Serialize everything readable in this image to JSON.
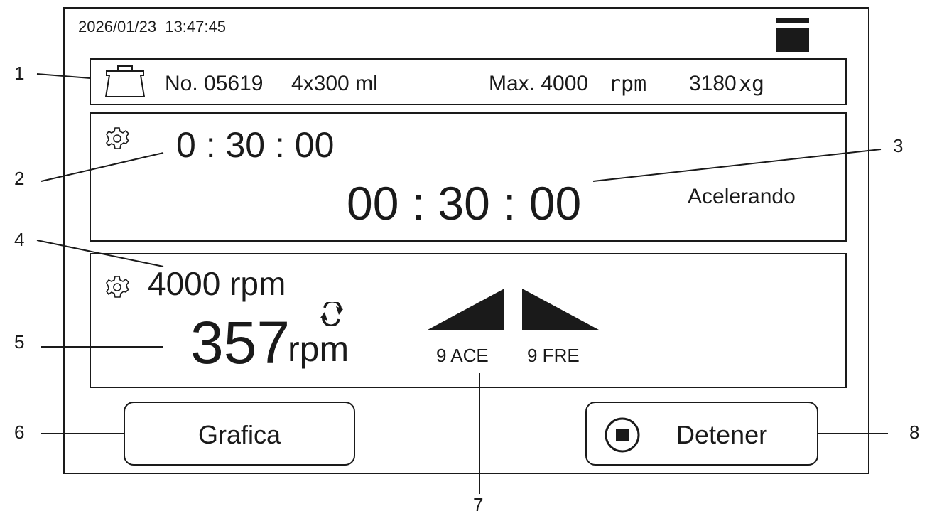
{
  "datetime": "2026/01/23  13:47:45",
  "rotor": {
    "number": "No. 05619",
    "capacity": "4x300 ml",
    "max_speed_label": "Max. 4000",
    "max_speed_unit": "rpm",
    "force_value": "3180",
    "force_unit": "xg"
  },
  "time": {
    "set_time": "0 : 30 : 00",
    "remaining_time": "00 : 30 : 00",
    "status": "Acelerando"
  },
  "speed": {
    "set_speed": "4000 rpm",
    "current_value": "357",
    "current_unit": "rpm",
    "accel_label": "9 ACE",
    "brake_label": "9 FRE"
  },
  "buttons": {
    "graph_label": "Grafica",
    "stop_label": "Detener"
  },
  "callouts": [
    "1",
    "2",
    "3",
    "4",
    "5",
    "6",
    "7",
    "8"
  ],
  "icons": {
    "battery": "battery-icon",
    "rotor": "rotor-icon",
    "set_time": "gear-icon",
    "set_speed": "gear-icon",
    "rotation": "rotation-arrows-icon",
    "accel": "acceleration-ramp-icon",
    "brake": "brake-ramp-icon",
    "stop": "stop-icon"
  }
}
